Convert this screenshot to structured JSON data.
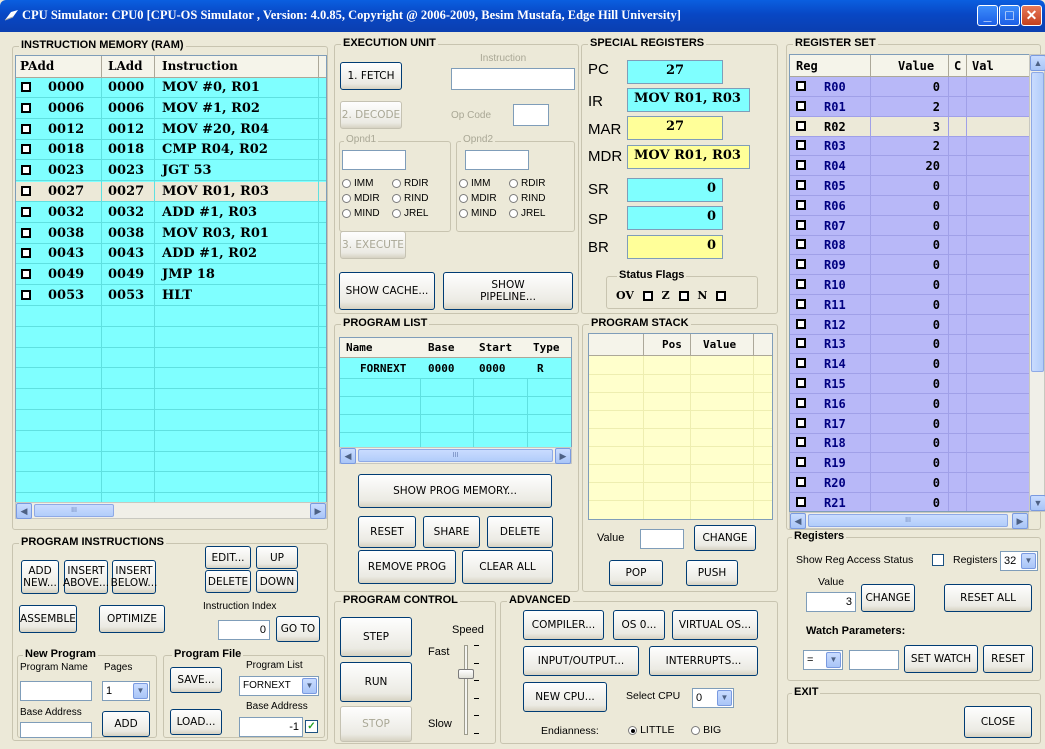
{
  "window": {
    "title": "CPU Simulator: CPU0    [CPU-OS Simulator , Version: 4.0.85, Copyright @ 2006-2009, Besim Mustafa, Edge Hill University]",
    "min": "_",
    "max": "□",
    "close": "✕"
  },
  "instruction_memory": {
    "title": "INSTRUCTION MEMORY (RAM)",
    "headers": [
      "PAdd",
      "LAdd",
      "Instruction"
    ],
    "rows": [
      {
        "padd": "0000",
        "ladd": "0000",
        "instr": "MOV #0, R01"
      },
      {
        "padd": "0006",
        "ladd": "0006",
        "instr": "MOV #1, R02"
      },
      {
        "padd": "0012",
        "ladd": "0012",
        "instr": "MOV #20, R04"
      },
      {
        "padd": "0018",
        "ladd": "0018",
        "instr": "CMP R04, R02"
      },
      {
        "padd": "0023",
        "ladd": "0023",
        "instr": "JGT 53"
      },
      {
        "padd": "0027",
        "ladd": "0027",
        "instr": "MOV R01, R03"
      },
      {
        "padd": "0032",
        "ladd": "0032",
        "instr": "ADD #1, R03"
      },
      {
        "padd": "0038",
        "ladd": "0038",
        "instr": "MOV R03, R01"
      },
      {
        "padd": "0043",
        "ladd": "0043",
        "instr": "ADD #1, R02"
      },
      {
        "padd": "0049",
        "ladd": "0049",
        "instr": "JMP 18"
      },
      {
        "padd": "0053",
        "ladd": "0053",
        "instr": "HLT"
      }
    ],
    "highlight_row": 5,
    "left_arrow": "◀",
    "thumb": "III",
    "right_arrow": "▶"
  },
  "program_instructions": {
    "title": "PROGRAM INSTRUCTIONS",
    "add_new": "ADD\nNEW...",
    "insert_above": "INSERT\nABOVE...",
    "insert_below": "INSERT\nBELOW...",
    "edit": "EDIT...",
    "delete": "DELETE",
    "up": "UP",
    "down": "DOWN",
    "assemble": "ASSEMBLE",
    "optimize": "OPTIMIZE",
    "instruction_index_label": "Instruction Index",
    "instruction_index": "0",
    "goto": "GO TO",
    "new_program": {
      "title": "New Program",
      "name_label": "Program Name",
      "pages_label": "Pages",
      "pages": "1",
      "base_label": "Base Address",
      "add": "ADD"
    },
    "program_file": {
      "title": "Program File",
      "list_label": "Program List",
      "list_value": "FORNEXT",
      "save": "SAVE...",
      "load": "LOAD...",
      "base_label": "Base Address",
      "base_value": "-1",
      "checkbox": "✓"
    }
  },
  "execution_unit": {
    "title": "EXECUTION UNIT",
    "fetch": "1. FETCH",
    "instruction_label": "Instruction",
    "decode": "2. DECODE",
    "opcode_label": "Op Code",
    "opnd1": "Opnd1",
    "opnd2": "Opnd2",
    "modes": [
      "IMM",
      "RDIR",
      "MDIR",
      "RIND",
      "MIND",
      "JREL"
    ],
    "execute": "3. EXECUTE",
    "show_cache": "SHOW CACHE...",
    "show_pipeline": "SHOW\nPIPELINE..."
  },
  "special_registers": {
    "title": "SPECIAL REGISTERS",
    "pc_label": "PC",
    "pc": "27",
    "ir_label": "IR",
    "ir": "MOV R01, R03",
    "mar_label": "MAR",
    "mar": "27",
    "mdr_label": "MDR",
    "mdr": "MOV R01, R03",
    "sr_label": "SR",
    "sr": "0",
    "sp_label": "SP",
    "sp": "0",
    "br_label": "BR",
    "br": "0",
    "flags_title": "Status Flags",
    "flag_ov": "OV",
    "flag_z": "Z",
    "flag_n": "N"
  },
  "program_list": {
    "title": "PROGRAM LIST",
    "headers": [
      "Name",
      "Base",
      "Start",
      "Type"
    ],
    "row": {
      "name": "FORNEXT",
      "base": "0000",
      "start": "0000",
      "type": "R"
    },
    "show_prog_memory": "SHOW PROG MEMORY...",
    "reset": "RESET",
    "share": "SHARE",
    "delete": "DELETE",
    "remove_prog": "REMOVE PROG",
    "clear_all": "CLEAR ALL",
    "left_arrow": "◀",
    "thumb": "III",
    "right_arrow": "▶"
  },
  "program_stack": {
    "title": "PROGRAM STACK",
    "headers": [
      "Pos",
      "Value"
    ],
    "value_label": "Value",
    "change": "CHANGE",
    "pop": "POP",
    "push": "PUSH"
  },
  "program_control": {
    "title": "PROGRAM CONTROL",
    "step": "STEP",
    "run": "RUN",
    "stop": "STOP",
    "speed": "Speed",
    "fast": "Fast",
    "slow": "Slow",
    "speed_level": 0.3
  },
  "advanced": {
    "title": "ADVANCED",
    "compiler": "COMPILER...",
    "os": "OS 0...",
    "virtual_os": "VIRTUAL OS...",
    "io": "INPUT/OUTPUT...",
    "interrupts": "INTERRUPTS...",
    "new_cpu": "NEW CPU...",
    "select_cpu_label": "Select CPU",
    "select_cpu": "0",
    "endianness_label": "Endianness:",
    "little": "LITTLE",
    "big": "BIG"
  },
  "register_set": {
    "title": "REGISTER SET",
    "headers": [
      "Reg",
      "Value",
      "C",
      "Val"
    ],
    "rows": [
      {
        "reg": "R00",
        "value": "0"
      },
      {
        "reg": "R01",
        "value": "2"
      },
      {
        "reg": "R02",
        "value": "3"
      },
      {
        "reg": "R03",
        "value": "2"
      },
      {
        "reg": "R04",
        "value": "20"
      },
      {
        "reg": "R05",
        "value": "0"
      },
      {
        "reg": "R06",
        "value": "0"
      },
      {
        "reg": "R07",
        "value": "0"
      },
      {
        "reg": "R08",
        "value": "0"
      },
      {
        "reg": "R09",
        "value": "0"
      },
      {
        "reg": "R10",
        "value": "0"
      },
      {
        "reg": "R11",
        "value": "0"
      },
      {
        "reg": "R12",
        "value": "0"
      },
      {
        "reg": "R13",
        "value": "0"
      },
      {
        "reg": "R14",
        "value": "0"
      },
      {
        "reg": "R15",
        "value": "0"
      },
      {
        "reg": "R16",
        "value": "0"
      },
      {
        "reg": "R17",
        "value": "0"
      },
      {
        "reg": "R18",
        "value": "0"
      },
      {
        "reg": "R19",
        "value": "0"
      },
      {
        "reg": "R20",
        "value": "0"
      },
      {
        "reg": "R21",
        "value": "0"
      }
    ],
    "highlight_row": 2,
    "up_arrow": "▲",
    "down_arrow": "▼",
    "left_arrow": "◀",
    "thumb": "III",
    "right_arrow": "▶"
  },
  "registers": {
    "title": "Registers",
    "show_access": "Show Reg Access Status",
    "count_label": "Registers",
    "count": "32",
    "value_label": "Value",
    "value": "3",
    "change": "CHANGE",
    "reset_all": "RESET ALL",
    "watch_title": "Watch Parameters:",
    "watch_op": "=",
    "set_watch": "SET WATCH",
    "reset": "RESET"
  },
  "exit": {
    "title": "EXIT",
    "close": "CLOSE"
  },
  "colors": {
    "cyan": "#7fffff",
    "yellow": "#ffff99",
    "reg_bg": "#b8b8f8",
    "highlight": "#ece9d8",
    "stack_bg": "#ffffcc",
    "program_list_bg": "#7fffff"
  }
}
